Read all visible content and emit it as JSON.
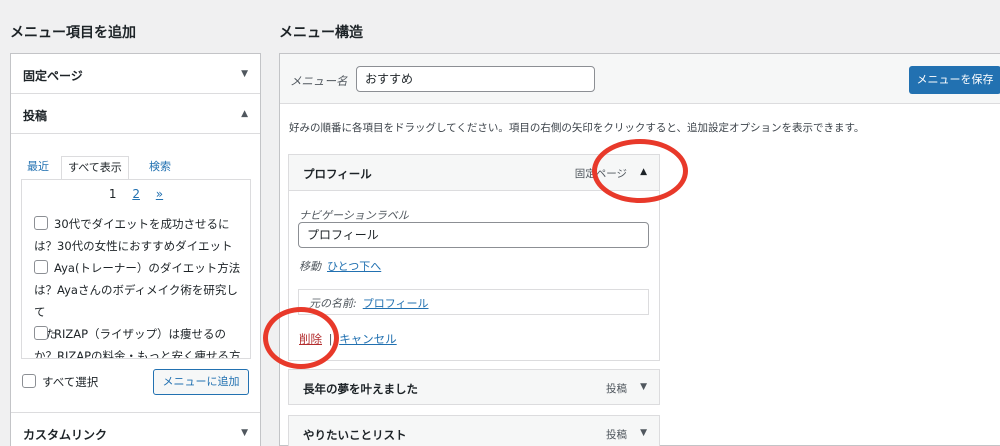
{
  "left": {
    "heading": "メニュー項目を追加",
    "fixed_page": "固定ページ",
    "posts": "投稿",
    "tabs": [
      "最近",
      "すべて表示",
      "検索"
    ],
    "pager": {
      "p1": "1",
      "p2": "2",
      "next": "»"
    },
    "post_items": [
      {
        "line1": "30代でダイエットを成功させるに",
        "line2": "は？30代の女性におすすめダイエット"
      },
      {
        "line1": "Aya(トレーナー）のダイエット方法",
        "line2": "は？Ayaさんのボディメイク術を研究して",
        "line3": "みた"
      },
      {
        "line1": "RIZAP（ライザップ）は痩せるの",
        "line2": "か？RIZAPの料金・もっと安く痩せる方"
      }
    ],
    "select_all": "すべて選択",
    "add_button": "メニューに追加",
    "custom_link": "カスタムリンク"
  },
  "right": {
    "heading": "メニュー構造",
    "menu_name_label": "メニュー名",
    "menu_name_value": "おすすめ",
    "save_button": "メニューを保存",
    "instruction": "好みの順番に各項目をドラッグしてください。項目の右側の矢印をクリックすると、追加設定オプションを表示できます。",
    "expanded_item": {
      "title": "プロフィール",
      "type": "固定ページ",
      "nav_label_caption": "ナビゲーションラベル",
      "nav_label_value": "プロフィール",
      "move_label": "移動",
      "move_link": "ひとつ下へ",
      "original_label": "元の名前:",
      "original_link": "プロフィール",
      "delete": "削除",
      "sep": "|",
      "cancel": "キャンセル"
    },
    "items": [
      {
        "title": "長年の夢を叶えました",
        "type": "投稿"
      },
      {
        "title": "やりたいことリスト",
        "type": "投稿"
      }
    ]
  },
  "colors": {
    "accent": "#2271b1",
    "annotation": "#e8392a",
    "delete": "#b32d2e"
  }
}
